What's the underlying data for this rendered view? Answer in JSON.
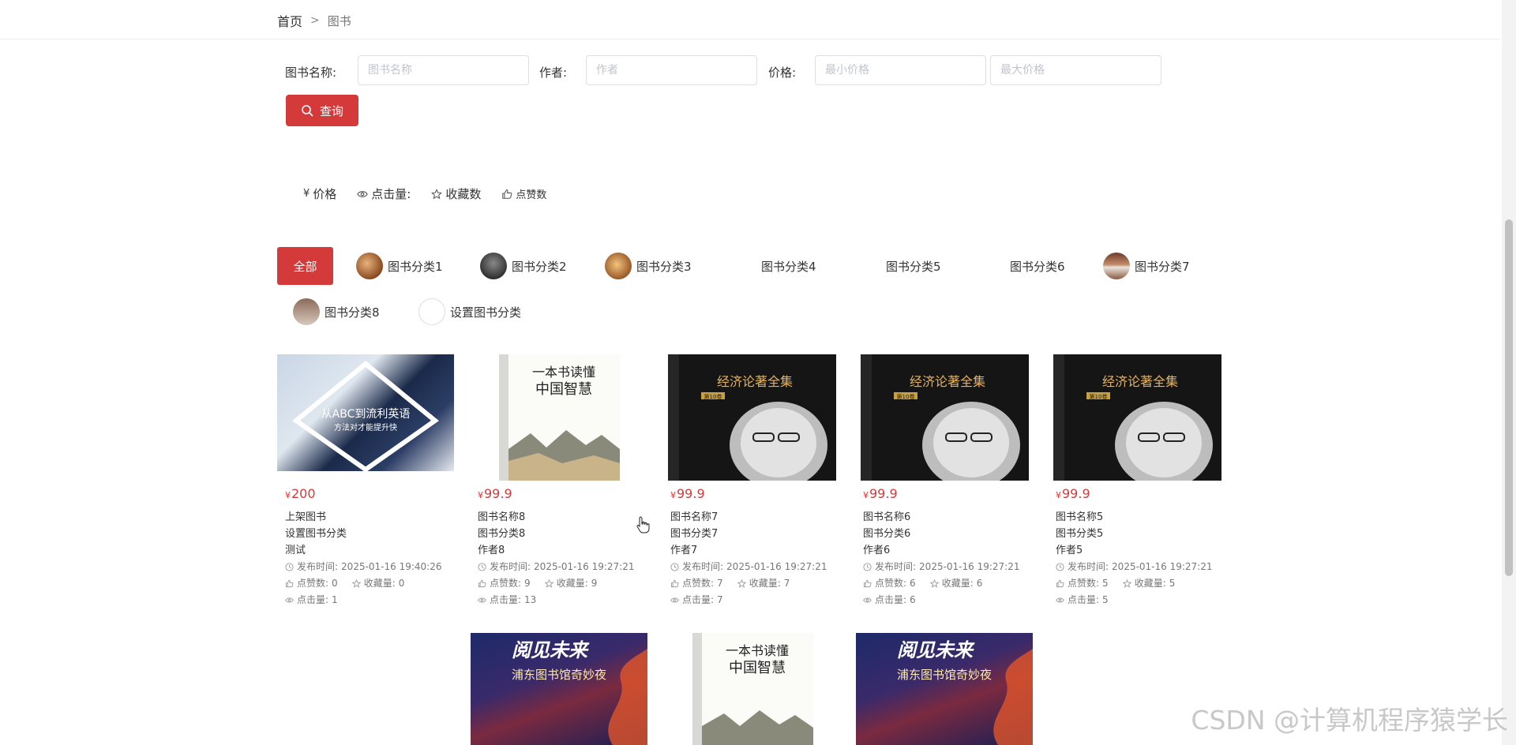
{
  "breadcrumb": {
    "home": "首页",
    "separator": ">",
    "current": "图书"
  },
  "search": {
    "name_label": "图书名称:",
    "name_placeholder": "图书名称",
    "author_label": "作者:",
    "author_placeholder": "作者",
    "price_label": "价格:",
    "min_price_placeholder": "最小价格",
    "max_price_placeholder": "最大价格",
    "button_label": "查询"
  },
  "sort": {
    "price": "价格",
    "clicks": "点击量:",
    "favorites": "收藏数",
    "likes": "点赞数"
  },
  "categories": {
    "all": "全部",
    "items": [
      "图书分类1",
      "图书分类2",
      "图书分类3",
      "图书分类4",
      "图书分类5",
      "图书分类6",
      "图书分类7",
      "图书分类8",
      "设置图书分类"
    ]
  },
  "books": [
    {
      "price": "200",
      "title": "上架图书",
      "category": "设置图书分类",
      "author": "测试",
      "time": "2025-01-16 19:40:26",
      "likes": "0",
      "favorites": "0",
      "clicks": "1",
      "cover_text": "从ABC到流利英语",
      "cover_sub": "方法对才能提升快"
    },
    {
      "price": "99.9",
      "title": "图书名称8",
      "category": "图书分类8",
      "author": "作者8",
      "time": "2025-01-16 19:27:21",
      "likes": "9",
      "favorites": "9",
      "clicks": "13",
      "cover_text": "一本书读懂",
      "cover_sub": "中国智慧"
    },
    {
      "price": "99.9",
      "title": "图书名称7",
      "category": "图书分类7",
      "author": "作者7",
      "time": "2025-01-16 19:27:21",
      "likes": "7",
      "favorites": "7",
      "clicks": "7",
      "cover_text": "经济论著全集",
      "cover_sub": "第10卷"
    },
    {
      "price": "99.9",
      "title": "图书名称6",
      "category": "图书分类6",
      "author": "作者6",
      "time": "2025-01-16 19:27:21",
      "likes": "6",
      "favorites": "6",
      "clicks": "6",
      "cover_text": "经济论著全集",
      "cover_sub": "第10卷"
    },
    {
      "price": "99.9",
      "title": "图书名称5",
      "category": "图书分类5",
      "author": "作者5",
      "time": "2025-01-16 19:27:21",
      "likes": "5",
      "favorites": "5",
      "clicks": "5",
      "cover_text": "经济论著全集",
      "cover_sub": "第10卷"
    }
  ],
  "bottom_books": [
    {
      "cover_text": "阅见未来",
      "cover_sub": "浦东图书馆奇妙夜"
    },
    {
      "cover_text": "一本书读懂",
      "cover_sub": "中国智慧"
    },
    {
      "cover_text": "阅见未来",
      "cover_sub": "浦东图书馆奇妙夜"
    }
  ],
  "labels": {
    "yen": "¥",
    "time": "发布时间:",
    "likes": "点赞数:",
    "favorites": "收藏量:",
    "clicks": "点击量:"
  },
  "watermark": "CSDN @计算机程序猿学长",
  "colors": {
    "accent": "#d53a3a",
    "border": "#dcdfe6",
    "muted": "#777777"
  }
}
